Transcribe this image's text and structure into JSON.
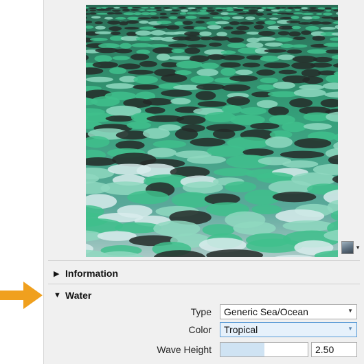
{
  "sections": {
    "information": {
      "title": "Information",
      "expanded": false
    },
    "water": {
      "title": "Water",
      "expanded": true
    }
  },
  "properties": {
    "type": {
      "label": "Type",
      "value": "Generic Sea/Ocean"
    },
    "color": {
      "label": "Color",
      "value": "Tropical"
    },
    "wave_height": {
      "label": "Wave Height",
      "value": "2.50",
      "slider_fraction": 0.5
    }
  },
  "preview": {
    "thumbnail_icon": "material-thumbnail-icon"
  },
  "colors": {
    "accent_arrow": "#f0a01e",
    "water_deep": "#252a28",
    "water_teal": "#3fbf8c",
    "water_light": "#d8ecec",
    "slider_fill": "#cfe3f3",
    "active_field_border": "#5b9bd5"
  }
}
